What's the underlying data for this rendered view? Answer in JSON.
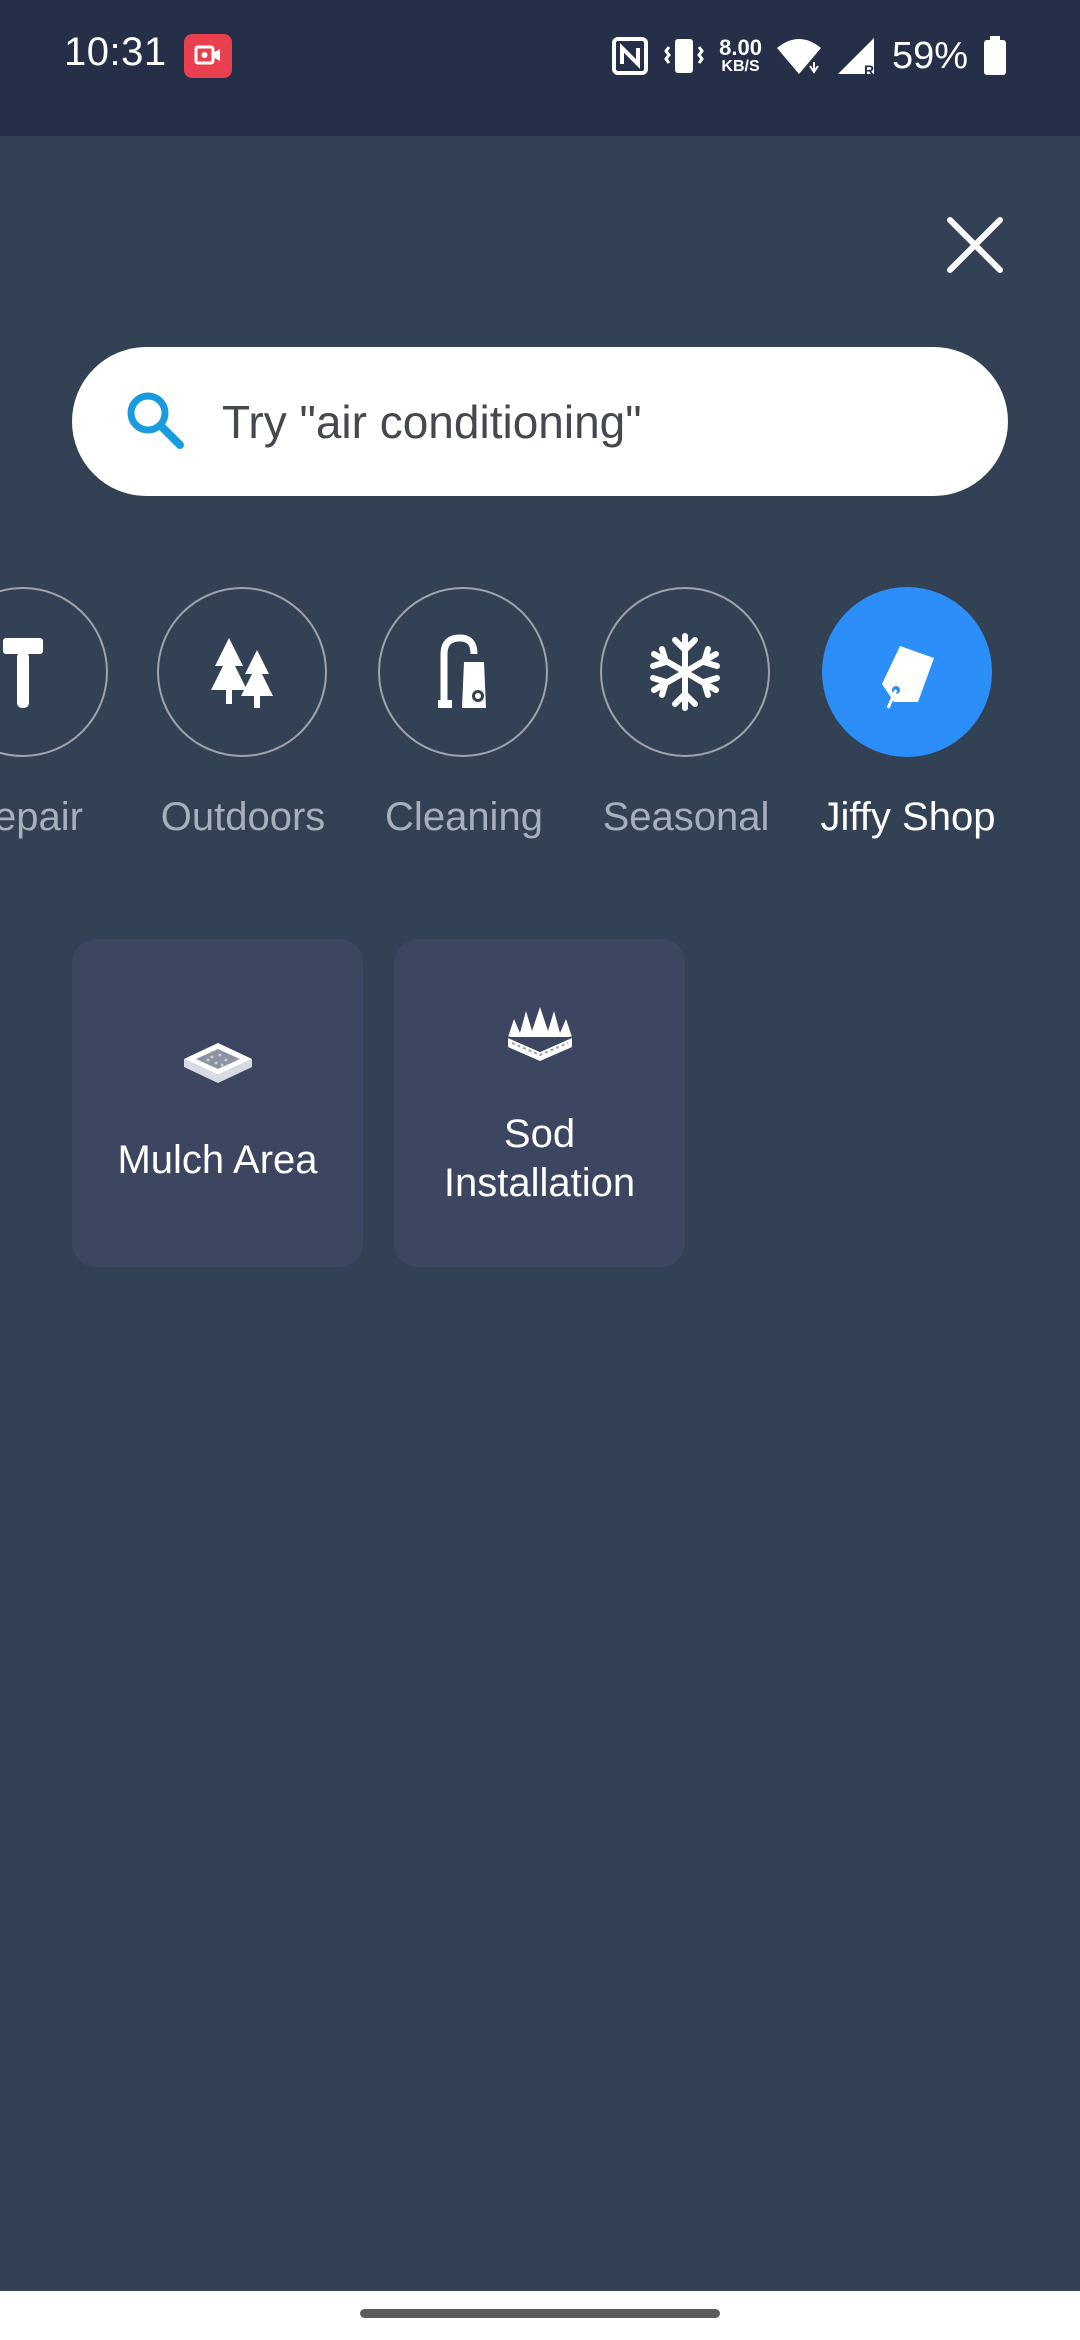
{
  "status_bar": {
    "time": "10:31",
    "net_speed_value": "8.00",
    "net_speed_unit": "KB/S",
    "battery_percent": "59%"
  },
  "search": {
    "placeholder": "Try \"air conditioning\""
  },
  "categories": [
    {
      "label": "Repair",
      "icon": "hammer-icon",
      "active": false
    },
    {
      "label": "Outdoors",
      "icon": "trees-icon",
      "active": false
    },
    {
      "label": "Cleaning",
      "icon": "vacuum-icon",
      "active": false
    },
    {
      "label": "Seasonal",
      "icon": "snowflake-icon",
      "active": false
    },
    {
      "label": "Jiffy Shop",
      "icon": "tag-icon",
      "active": true
    }
  ],
  "services": [
    {
      "label": "Mulch Area",
      "icon": "mulch-icon"
    },
    {
      "label": "Sod Installation",
      "icon": "sod-icon"
    }
  ],
  "colors": {
    "background": "#334154",
    "status_bar": "#252f48",
    "accent": "#2c8ef8",
    "card": "#3d4660",
    "search_icon": "#1a9be0"
  }
}
